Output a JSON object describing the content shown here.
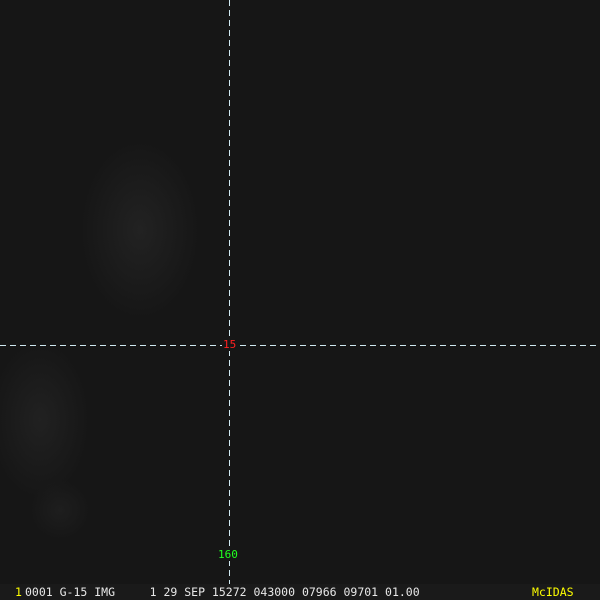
{
  "image": {
    "frame_number": "1",
    "info_line": "0001 G-15 IMG     1 29 SEP 15272 043000 07966 09701 01.00",
    "logo": "McIDAS"
  },
  "crosshair": {
    "latitude_label": "15",
    "longitude_label": "160"
  },
  "colors": {
    "latitude": "#ff2020",
    "longitude": "#20ff20",
    "logo": "#ffff00",
    "crosshair": "#cfe8f0"
  }
}
